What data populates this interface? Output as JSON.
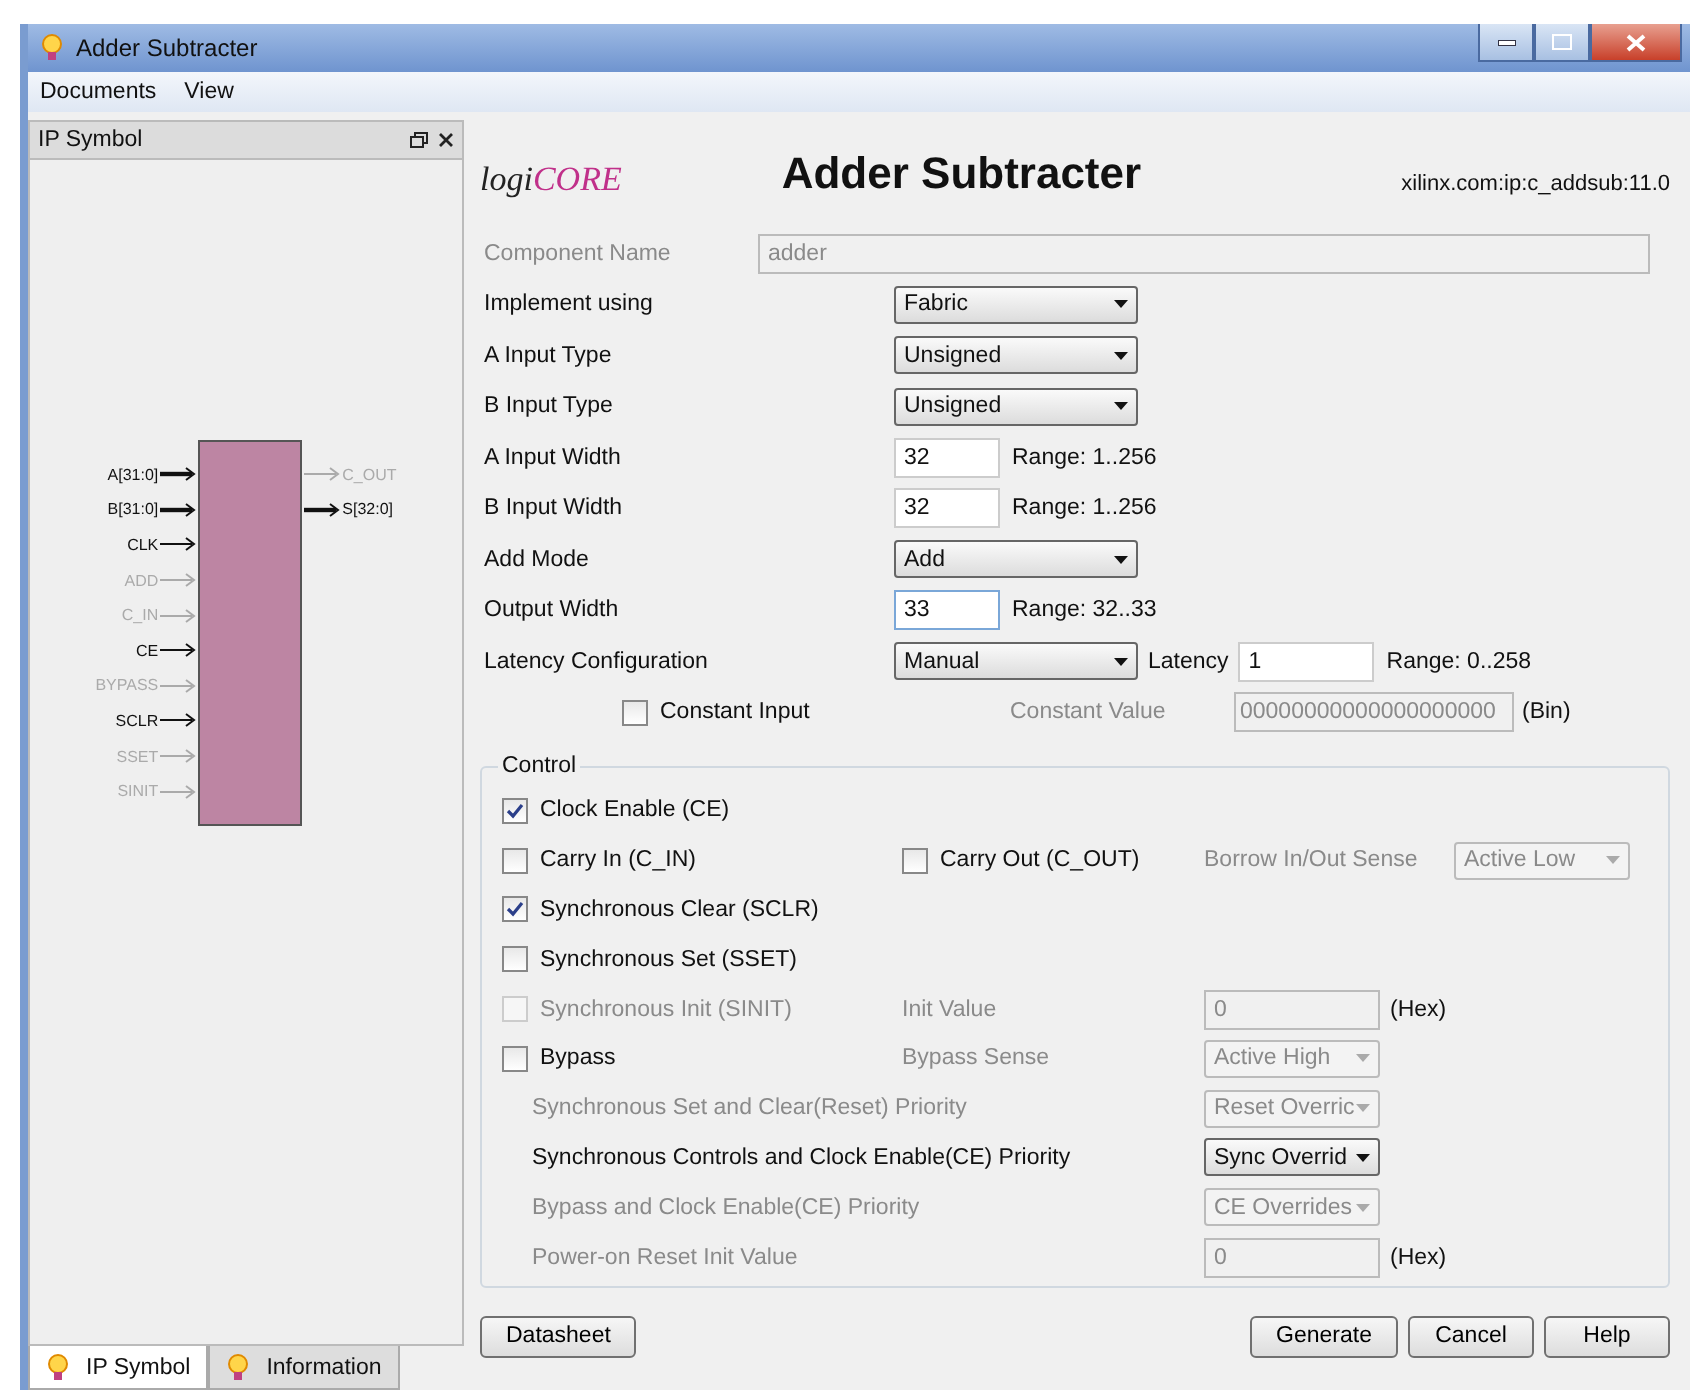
{
  "window": {
    "title": "Adder Subtracter"
  },
  "menu": [
    "Documents",
    "View"
  ],
  "left_panel": {
    "title": "IP Symbol",
    "inputs": [
      {
        "label": "A[31:0]",
        "enabled": true,
        "bus": true
      },
      {
        "label": "B[31:0]",
        "enabled": true,
        "bus": true
      },
      {
        "label": "CLK",
        "enabled": true,
        "bus": false
      },
      {
        "label": "ADD",
        "enabled": false,
        "bus": false
      },
      {
        "label": "C_IN",
        "enabled": false,
        "bus": false
      },
      {
        "label": "CE",
        "enabled": true,
        "bus": false
      },
      {
        "label": "BYPASS",
        "enabled": false,
        "bus": false
      },
      {
        "label": "SCLR",
        "enabled": true,
        "bus": false
      },
      {
        "label": "SSET",
        "enabled": false,
        "bus": false
      },
      {
        "label": "SINIT",
        "enabled": false,
        "bus": false
      }
    ],
    "outputs": [
      {
        "label": "C_OUT",
        "enabled": false,
        "bus": false
      },
      {
        "label": "S[32:0]",
        "enabled": true,
        "bus": true
      }
    ],
    "tabs": [
      {
        "label": "IP Symbol",
        "selected": true
      },
      {
        "label": "Information",
        "selected": false
      }
    ]
  },
  "header": {
    "logo": {
      "text_1": "logi",
      "text_2": "CORE"
    },
    "title": "Adder Subtracter",
    "ip_id": "xilinx.com:ip:c_addsub:11.0"
  },
  "fields": [
    {
      "kind": "text",
      "label": "Component Name",
      "value": "adder",
      "disabled": true
    },
    {
      "kind": "select",
      "label": "Implement using",
      "value": "Fabric"
    },
    {
      "kind": "select",
      "label": "A Input Type",
      "value": "Unsigned"
    },
    {
      "kind": "select",
      "label": "B Input Type",
      "value": "Unsigned"
    },
    {
      "kind": "number",
      "label": "A Input Width",
      "value": "32",
      "range": "Range: 1..256",
      "focused": false
    },
    {
      "kind": "number",
      "label": "B Input Width",
      "value": "32",
      "range": "Range: 1..256",
      "focused": false
    },
    {
      "kind": "select",
      "label": "Add Mode",
      "value": "Add"
    },
    {
      "kind": "number",
      "label": "Output Width",
      "value": "33",
      "range": "Range: 32..33",
      "focused": true
    },
    {
      "kind": "latency",
      "label": "Latency Configuration",
      "value": "Manual",
      "latency_label": "Latency",
      "latency_value": "1",
      "range": "Range: 0..258"
    },
    {
      "kind": "constant",
      "check_label": "Constant Input",
      "checked": false,
      "value_label": "Constant Value",
      "value": "00000000000000000000",
      "unit": "(Bin)",
      "disabled": true
    }
  ],
  "control": {
    "title": "Control",
    "rows": [
      {
        "kind": "check",
        "check": {
          "label": "Clock Enable (CE)",
          "checked": true,
          "disabled": false
        }
      },
      {
        "kind": "carry",
        "check": {
          "label": "Carry In (C_IN)",
          "checked": false,
          "disabled": false
        },
        "check_2": {
          "label": "Carry Out (C_OUT)",
          "checked": false,
          "disabled": false
        },
        "label": "Borrow In/Out Sense",
        "select": {
          "value": "Active Low",
          "disabled": true
        }
      },
      {
        "kind": "check",
        "check": {
          "label": "Synchronous Clear (SCLR)",
          "checked": true,
          "disabled": false
        }
      },
      {
        "kind": "check",
        "check": {
          "label": "Synchronous Set (SSET)",
          "checked": false,
          "disabled": false
        }
      },
      {
        "kind": "check_value",
        "check": {
          "label": "Synchronous Init (SINIT)",
          "checked": false,
          "disabled": true
        },
        "label": "Init Value",
        "field": {
          "value": "0",
          "disabled": true
        },
        "unit": "(Hex)"
      },
      {
        "kind": "check_select",
        "check": {
          "label": "Bypass",
          "checked": false,
          "disabled": false
        },
        "label": "Bypass Sense",
        "select": {
          "value": "Active High",
          "disabled": true
        }
      },
      {
        "kind": "priority",
        "label": "Synchronous Set and Clear(Reset) Priority",
        "select": {
          "value": "Reset Overric",
          "disabled": true
        }
      },
      {
        "kind": "priority",
        "label": "Synchronous Controls and Clock Enable(CE) Priority",
        "select": {
          "value": "Sync Overrid",
          "disabled": false
        }
      },
      {
        "kind": "priority",
        "label": "Bypass and Clock Enable(CE) Priority",
        "select": {
          "value": "CE Overrides",
          "disabled": true
        }
      },
      {
        "kind": "priority_value",
        "label": "Power-on Reset Init Value",
        "field": {
          "value": "0",
          "disabled": true
        },
        "unit": "(Hex)"
      }
    ]
  },
  "buttons_left": [
    "Datasheet"
  ],
  "buttons_right": [
    "Generate",
    "Cancel",
    "Help"
  ]
}
